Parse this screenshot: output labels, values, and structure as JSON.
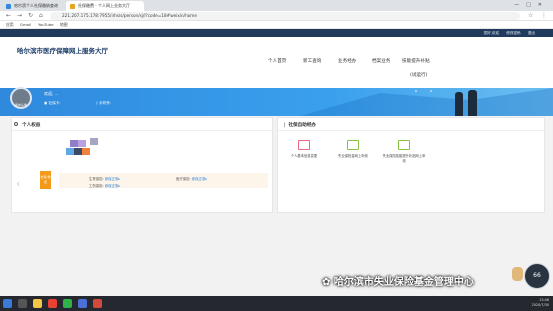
{
  "browser": {
    "tabs": [
      {
        "label": "哈尔滨个人社保缴纳查询"
      },
      {
        "label": "社保缴费 - 个人网上业务大厅"
      }
    ],
    "url": "221.207.175.178:7955/irhsis/person/sj/l?code=18#weixin/home",
    "bookmarks": [
      "应用",
      "Gmail",
      "YouTube",
      "地图"
    ]
  },
  "top_links": [
    "您好,欢迎",
    "修改密码",
    "退出"
  ],
  "site_title": "哈尔滨市医疗保障网上服务大厅",
  "nav": [
    "个人首页",
    "新工查询",
    "业务经办",
    "档案业务",
    "技能提升补贴",
    "(试运行)"
  ],
  "user": {
    "avatar_label": "我的头像",
    "name": "欢迎,",
    "name_suffix": "...",
    "id_label": "社保卡:",
    "phone_label": "手机号:"
  },
  "personal_rights": {
    "title": "个人权益",
    "badge_label": "社保\n缴费",
    "rows": [
      {
        "label": "生育保险:",
        "value": "参保正常▸"
      },
      {
        "label": "医疗保险:",
        "value": "参保正常▸"
      },
      {
        "label": "工伤保险:",
        "value": "参保正常▸"
      }
    ]
  },
  "self_service": {
    "title": "社保自助经办",
    "items": [
      {
        "label": "个人基本信息变更"
      },
      {
        "label": "失业保险金网上申领"
      },
      {
        "label": "失业保险技能提升补贴网上申领"
      }
    ]
  },
  "chat_widget": {
    "value": "66"
  },
  "watermark": "哈尔滨市失业保险基金管理中心",
  "taskbar": {
    "time": "13:46",
    "date": "2020/7/30"
  },
  "colors": {
    "accent": "#2f89dd",
    "orange": "#f39a1d",
    "link": "#2d7fd7"
  }
}
